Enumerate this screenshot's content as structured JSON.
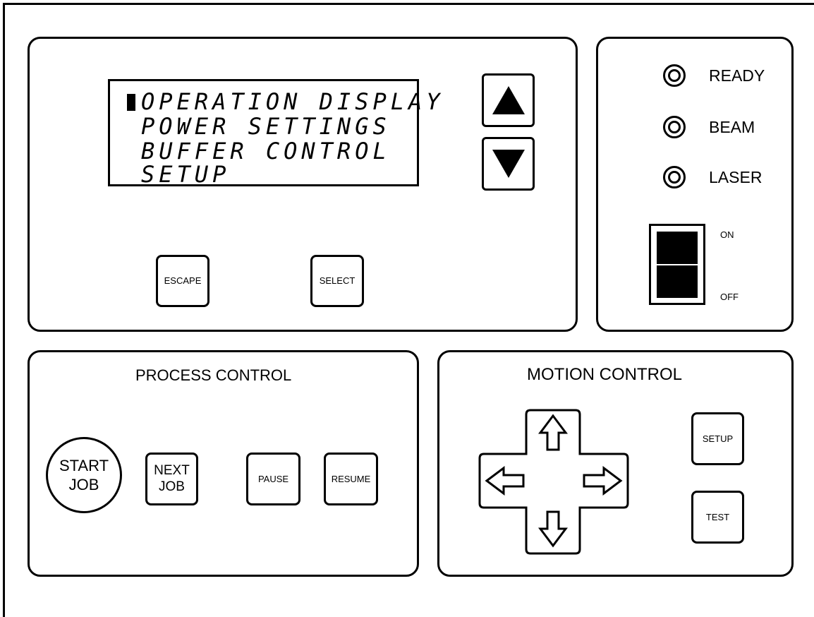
{
  "display": {
    "menu_items": [
      "OPERATION DISPLAY",
      "POWER SETTINGS",
      "BUFFER CONTROL",
      "SETUP"
    ],
    "selected_index": 0
  },
  "menu_buttons": {
    "escape_label": "ESCAPE",
    "select_label": "SELECT"
  },
  "status": {
    "indicators": [
      {
        "label": "READY"
      },
      {
        "label": "BEAM"
      },
      {
        "label": "LASER"
      }
    ],
    "power_switch": {
      "on_label": "ON",
      "off_label": "OFF"
    }
  },
  "process_control": {
    "title": "PROCESS CONTROL",
    "start_job": [
      "START",
      "JOB"
    ],
    "next_job": [
      "NEXT",
      "JOB"
    ],
    "pause_label": "PAUSE",
    "resume_label": "RESUME"
  },
  "motion_control": {
    "title": "MOTION CONTROL",
    "setup_label": "SETUP",
    "test_label": "TEST"
  },
  "icons": [
    "up-arrow-icon",
    "down-arrow-icon",
    "left-arrow-icon",
    "right-arrow-icon"
  ],
  "colors": {
    "ink": "#000000",
    "background": "#ffffff"
  }
}
